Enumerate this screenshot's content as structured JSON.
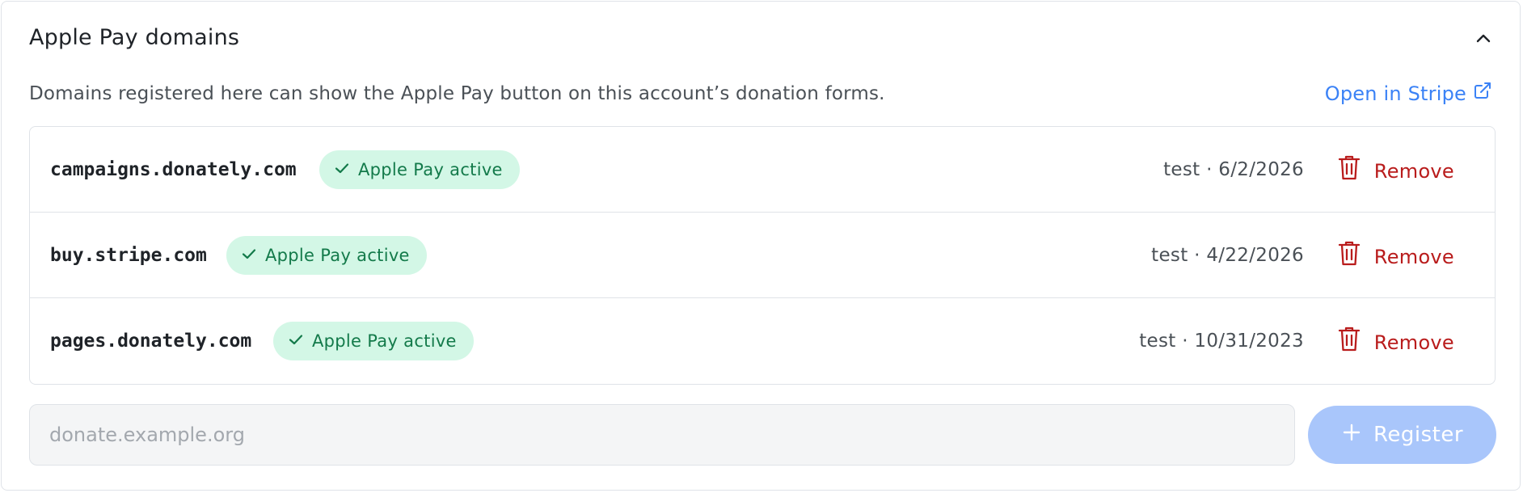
{
  "section": {
    "title": "Apple Pay domains",
    "description": "Domains registered here can show the Apple Pay button on this account’s donation forms.",
    "open_link_label": "Open in Stripe"
  },
  "domains": [
    {
      "name": "campaigns.donately.com",
      "status": "Apple Pay active",
      "meta": "test · 6/2/2026",
      "remove_label": "Remove"
    },
    {
      "name": "buy.stripe.com",
      "status": "Apple Pay active",
      "meta": "test · 4/22/2026",
      "remove_label": "Remove"
    },
    {
      "name": "pages.donately.com",
      "status": "Apple Pay active",
      "meta": "test · 10/31/2023",
      "remove_label": "Remove"
    }
  ],
  "add_form": {
    "placeholder": "donate.example.org",
    "value": "",
    "register_label": "Register"
  },
  "colors": {
    "accent": "#3b82f6",
    "badge_bg": "#d3f7e6",
    "badge_text": "#137a4a",
    "danger": "#b91c1c",
    "register_disabled": "#a9c6fb"
  },
  "icons": {
    "collapse": "chevron-up-icon",
    "external": "external-link-icon",
    "status": "check-icon",
    "remove": "trash-icon",
    "register": "plus-icon"
  }
}
